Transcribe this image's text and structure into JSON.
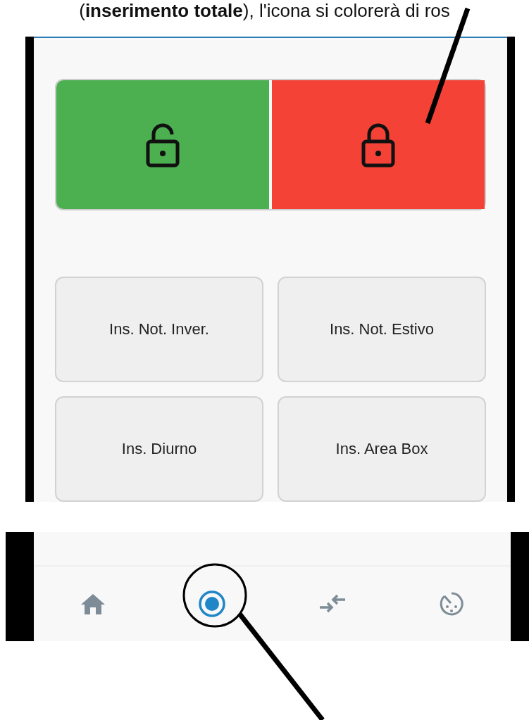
{
  "caption": "(**inserimento totale**), l'icona si colorerà di ros",
  "lock_toggle": [
    {
      "kind": "unlocked",
      "color": "#4caf50",
      "selected": false
    },
    {
      "kind": "locked",
      "color": "#f44336",
      "selected": true
    }
  ],
  "mode_buttons": [
    "Ins. Not. Inver.",
    "Ins. Not. Estivo",
    "Ins. Diurno",
    "Ins. Area Box"
  ],
  "bottom_nav": [
    {
      "kind": "home",
      "selected": false
    },
    {
      "kind": "target",
      "selected": true
    },
    {
      "kind": "swap",
      "selected": false
    },
    {
      "kind": "gauge",
      "selected": false
    }
  ]
}
